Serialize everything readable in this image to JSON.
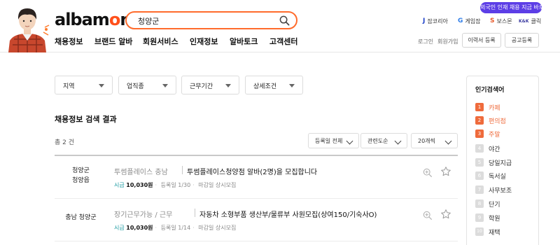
{
  "header": {
    "logo_main": "albam",
    "logo_accent": "o",
    "logo_end": "n",
    "search_value": "청양군",
    "promo_badge": "외국인 인재 채용 지금 바로!",
    "family_sites": [
      {
        "icon": "J",
        "label": "잡코리아",
        "color": "#1b3fc8"
      },
      {
        "icon": "G",
        "label": "게임잡",
        "color": "#2e7de8"
      },
      {
        "icon": "S",
        "label": "보스몬",
        "color": "#e85a2a"
      },
      {
        "icon": "K&K",
        "label": "클릭",
        "color": "#3a3aa0"
      }
    ],
    "nav": [
      "채용정보",
      "브랜드 알바",
      "회원서비스",
      "인재정보",
      "알바토크",
      "고객센터"
    ],
    "util": {
      "login": "로그인",
      "signup": "회원가입",
      "resume_btn": "이력서 등록",
      "post_btn": "공고등록"
    }
  },
  "filters": [
    "지역",
    "업직종",
    "근무기간",
    "상세조건"
  ],
  "results": {
    "title": "채용정보 검색 결과",
    "count": "총 2 건",
    "sort_options": [
      "등록일 전체",
      "관련도순",
      "20개씩"
    ]
  },
  "jobs": [
    {
      "location_lines": [
        "청양군",
        "청양읍"
      ],
      "company": "투썸플레이스 충남",
      "title": "투썸플레이스청양점 알바(2명)을 모집합니다",
      "wage_label": "시급",
      "wage": "10,030원",
      "posted": "등록일 1/30",
      "deadline": "마감일 상시모집"
    },
    {
      "location_lines": [
        "충남 청양군"
      ],
      "company": "장기근무가능 / 근무",
      "title": "자동차 소형부품 생산부/물류부 사원모집(상여150/기숙사O)",
      "wage_label": "시급",
      "wage": "10,030원",
      "posted": "등록일 1/14",
      "deadline": "마감일 상시모집"
    }
  ],
  "popular": {
    "title": "인기검색어",
    "items": [
      {
        "rank": "1",
        "keyword": "카페",
        "hot": true
      },
      {
        "rank": "2",
        "keyword": "편의점",
        "hot": true
      },
      {
        "rank": "3",
        "keyword": "주말",
        "hot": true
      },
      {
        "rank": "4",
        "keyword": "야간",
        "hot": false
      },
      {
        "rank": "5",
        "keyword": "당일지급",
        "hot": false
      },
      {
        "rank": "6",
        "keyword": "독서실",
        "hot": false
      },
      {
        "rank": "7",
        "keyword": "사무보조",
        "hot": false
      },
      {
        "rank": "8",
        "keyword": "단기",
        "hot": false
      },
      {
        "rank": "9",
        "keyword": "학원",
        "hot": false
      },
      {
        "rank": "10",
        "keyword": "재택",
        "hot": false
      }
    ]
  },
  "colors": {
    "brand": "#ff501b",
    "promo": "#5c3ee6",
    "hot": "#ef6b3c",
    "wage": "#1b9aa0"
  }
}
